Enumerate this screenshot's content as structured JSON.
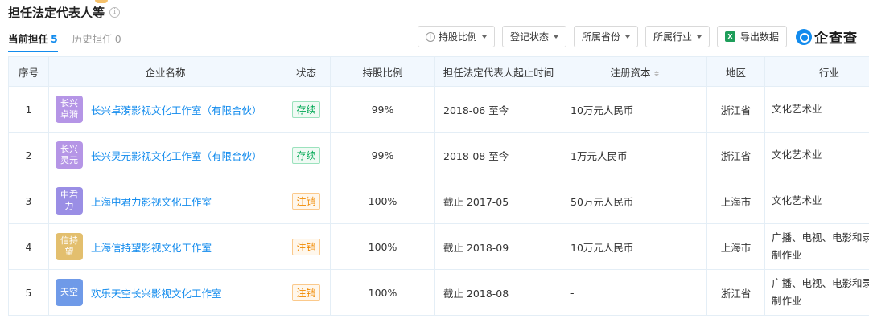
{
  "page": {
    "title": "担任法定代表人等",
    "tabs": [
      {
        "label": "当前担任",
        "count": "5"
      },
      {
        "label": "历史担任",
        "count": "0"
      }
    ]
  },
  "toolbar": {
    "shareholding": "持股比例",
    "reg_status": "登记状态",
    "province": "所属省份",
    "industry": "所属行业",
    "export": "导出数据",
    "brand": "企查查"
  },
  "table": {
    "headers": [
      "序号",
      "企业名称",
      "状态",
      "持股比例",
      "担任法定代表人起止时间",
      "注册资本",
      "地区",
      "行业"
    ],
    "rows": [
      {
        "no": "1",
        "avatar": "长兴卓漪",
        "avatar_color": "#b595e6",
        "name": "长兴卓漪影视文化工作室（有限合伙）",
        "status": "存续",
        "status_type": "green",
        "share": "99%",
        "period": "2018-06 至今",
        "capital": "10万元人民币",
        "region": "浙江省",
        "industry": "文化艺术业"
      },
      {
        "no": "2",
        "avatar": "长兴灵元",
        "avatar_color": "#b595e6",
        "name": "长兴灵元影视文化工作室（有限合伙）",
        "status": "存续",
        "status_type": "green",
        "share": "99%",
        "period": "2018-08 至今",
        "capital": "1万元人民币",
        "region": "浙江省",
        "industry": "文化艺术业"
      },
      {
        "no": "3",
        "avatar": "中君力",
        "avatar_color": "#9a8ee5",
        "name": "上海中君力影视文化工作室",
        "status": "注销",
        "status_type": "orange",
        "share": "100%",
        "period": "截止 2017-05",
        "capital": "50万元人民币",
        "region": "上海市",
        "industry": "文化艺术业"
      },
      {
        "no": "4",
        "avatar": "信持望",
        "avatar_color": "#e3bf6e",
        "name": "上海信持望影视文化工作室",
        "status": "注销",
        "status_type": "orange",
        "share": "100%",
        "period": "截止 2018-09",
        "capital": "10万元人民币",
        "region": "上海市",
        "industry": "广播、电视、电影和录音制作业"
      },
      {
        "no": "5",
        "avatar": "天空",
        "avatar_color": "#6f9ae8",
        "name": "欢乐天空长兴影视文化工作室",
        "status": "注销",
        "status_type": "orange",
        "share": "100%",
        "period": "截止 2018-08",
        "capital": "-",
        "region": "浙江省",
        "industry": "广播、电视、电影和录音制作业"
      }
    ]
  }
}
